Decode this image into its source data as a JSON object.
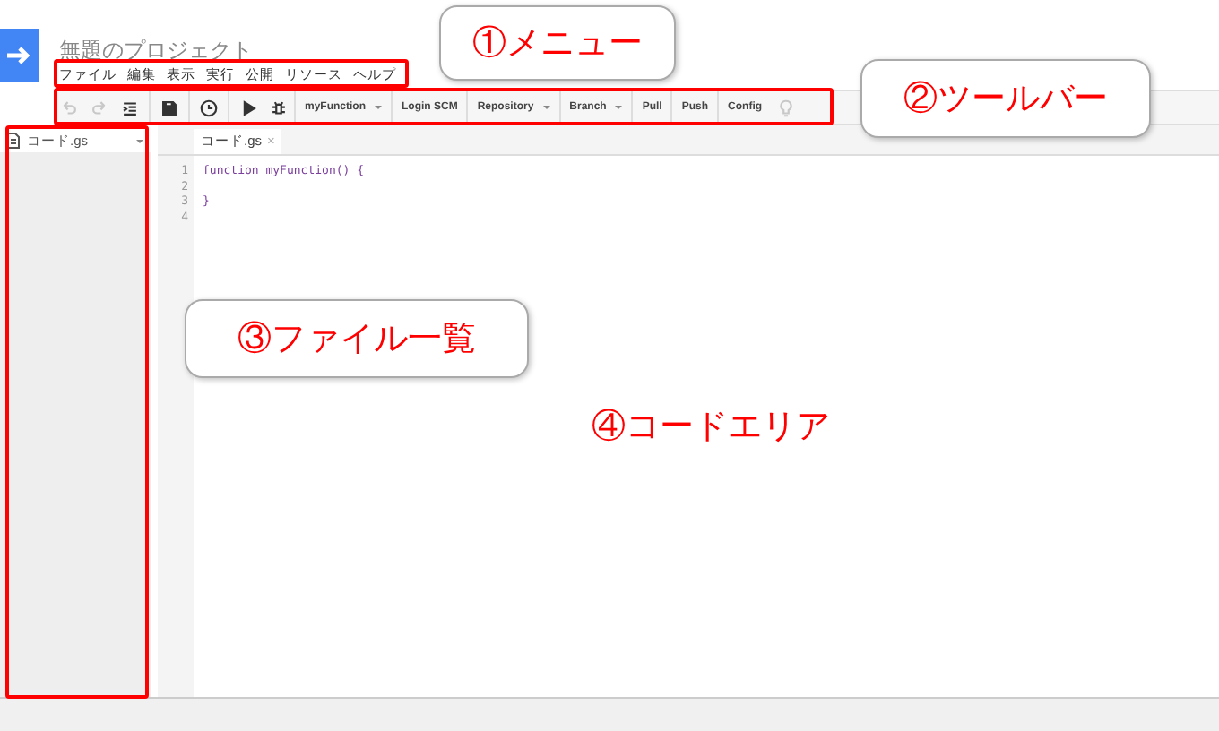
{
  "header": {
    "title": "無題のプロジェクト"
  },
  "menu": [
    "ファイル",
    "編集",
    "表示",
    "実行",
    "公開",
    "リソース",
    "ヘルプ"
  ],
  "toolbar": [
    {
      "kind": "undo",
      "disabled": true
    },
    {
      "kind": "redo",
      "disabled": true
    },
    {
      "kind": "indent",
      "disabled": false
    },
    {
      "kind": "sep"
    },
    {
      "kind": "save",
      "disabled": false
    },
    {
      "kind": "sep"
    },
    {
      "kind": "clock",
      "disabled": false
    },
    {
      "kind": "sep"
    },
    {
      "kind": "run",
      "disabled": false
    },
    {
      "kind": "bug",
      "disabled": false
    },
    {
      "kind": "dropdown",
      "label": "myFunction"
    },
    {
      "kind": "button",
      "label": "Login SCM"
    },
    {
      "kind": "dropdown",
      "label": "Repository"
    },
    {
      "kind": "dropdown",
      "label": "Branch"
    },
    {
      "kind": "button",
      "label": "Pull"
    },
    {
      "kind": "button",
      "label": "Push"
    },
    {
      "kind": "button",
      "label": "Config"
    },
    {
      "kind": "bulb",
      "disabled": true
    }
  ],
  "files": [
    {
      "name": "コード.gs",
      "selected": true
    }
  ],
  "tabs": [
    {
      "label": "コード.gs",
      "close": "×",
      "selected": true
    }
  ],
  "code": [
    {
      "number": "1",
      "text": "function myFunction() {"
    },
    {
      "number": "2"
    },
    {
      "number": "3",
      "text": "}"
    },
    {
      "number": "4"
    }
  ],
  "callouts": [
    {
      "label": "①メニュー"
    },
    {
      "label": "②ツールバー"
    },
    {
      "label": "③ファイル一覧"
    },
    {
      "label": "④コードエリア"
    }
  ]
}
